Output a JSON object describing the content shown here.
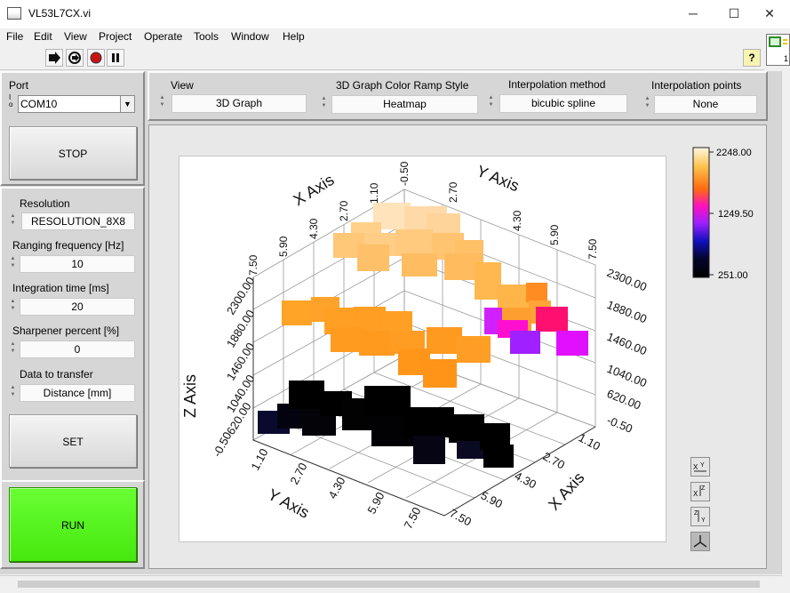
{
  "window": {
    "title": "VL53L7CX.vi",
    "minimize": "─",
    "maximize": "☐",
    "close": "✕"
  },
  "menu": [
    "File",
    "Edit",
    "View",
    "Project",
    "Operate",
    "Tools",
    "Window",
    "Help"
  ],
  "toolbar": {
    "run_icon": "run-arrow-icon",
    "continuous_icon": "run-continuously-icon",
    "abort_icon": "abort-icon",
    "pause_icon": "pause-icon",
    "help_label": "?"
  },
  "connector_badge": "1",
  "left": {
    "port_label": "Port",
    "port_prefix": "I/o",
    "port_value": "COM10",
    "stop_label": "STOP",
    "resolution_label": "Resolution",
    "resolution_value": "RESOLUTION_8X8",
    "ranging_label": "Ranging frequency [Hz]",
    "ranging_value": "10",
    "integration_label": "Integration time [ms]",
    "integration_value": "20",
    "sharpener_label": "Sharpener percent [%]",
    "sharpener_value": "0",
    "transfer_label": "Data to transfer",
    "transfer_value": "Distance [mm]",
    "set_label": "SET",
    "run_label": "RUN"
  },
  "top": {
    "view_label": "View",
    "view_value": "3D Graph",
    "ramp_label": "3D Graph Color Ramp Style",
    "ramp_value": "Heatmap",
    "interp_label": "Interpolation method",
    "interp_value": "bicubic spline",
    "points_label": "Interpolation points",
    "points_value": "None"
  },
  "graph": {
    "colorbar": {
      "max": "2248.00",
      "mid": "1249.50",
      "min": "251.00"
    },
    "axes": {
      "x_title": "X Axis",
      "y_title": "Y Axis",
      "z_title": "Z Axis",
      "xy_ticks": [
        "-0.50",
        "1.10",
        "2.70",
        "4.30",
        "5.90",
        "7.50"
      ],
      "z_ticks": [
        "620.00",
        "1040.00",
        "1460.00",
        "1880.00",
        "2300.00"
      ],
      "z_ticks_left": [
        "620.00",
        "1040.00",
        "1460.00",
        "1880.00",
        "2300.00"
      ]
    },
    "colors": {
      "black": "#000000",
      "navy": "#0a0a2a",
      "orange": "#ffa524",
      "light_orange": "#ffc26a",
      "peach": "#ffe0b0",
      "magenta": "#ff10d0",
      "violet": "#a020ff",
      "pink": "#ff2060"
    },
    "controls": [
      "xy-plane-icon",
      "xz-plane-icon",
      "yz-plane-icon",
      "projection-icon"
    ]
  }
}
